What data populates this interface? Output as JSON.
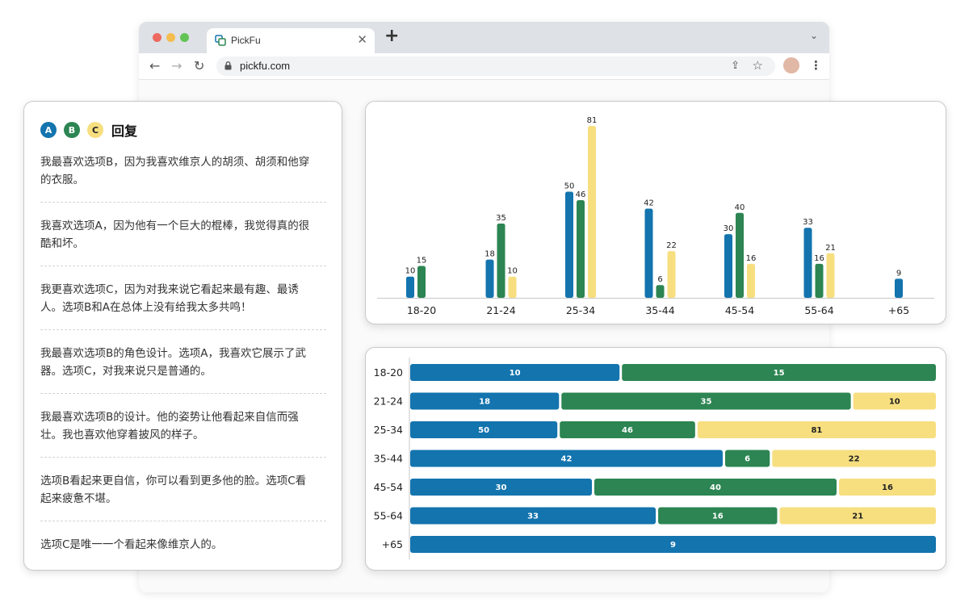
{
  "browser": {
    "tab_title": "PickFu",
    "url": "pickfu.com"
  },
  "responses": {
    "badges": [
      "A",
      "B",
      "C"
    ],
    "title": "回复",
    "items": [
      [
        "我最喜欢选项B，因为我喜欢维京人的胡须、胡须和他穿",
        "的衣服。"
      ],
      [
        "我喜欢选项A，因为他有一个巨大的棍棒，我觉得真的很",
        "酷和坏。"
      ],
      [
        "我更喜欢选项C，因为对我来说它看起来最有趣、最诱",
        "人。选项B和A在总体上没有给我太多共鸣！"
      ],
      [
        "我最喜欢选项B的角色设计。选项A，我喜欢它展示了武",
        "器。选项C，对我来说只是普通的。"
      ],
      [
        "我最喜欢选项B的设计。他的姿势让他看起来自信而强",
        "壮。我也喜欢他穿着披风的样子。"
      ],
      [
        "选项B看起来更自信，你可以看到更多他的脸。选项C看",
        "起来疲惫不堪。"
      ],
      [
        "选项C是唯一一个看起来像维京人的。"
      ]
    ]
  },
  "colors": {
    "A": "#1374ae",
    "B": "#2c8552",
    "C": "#f7df80"
  },
  "chart_data": [
    {
      "type": "bar",
      "categories": [
        "18-20",
        "21-24",
        "25-34",
        "35-44",
        "45-54",
        "55-64",
        "+65"
      ],
      "series": [
        {
          "name": "A",
          "values": [
            10,
            18,
            50,
            42,
            30,
            33,
            9
          ]
        },
        {
          "name": "B",
          "values": [
            15,
            35,
            46,
            6,
            40,
            16,
            null
          ]
        },
        {
          "name": "C",
          "values": [
            null,
            10,
            81,
            22,
            16,
            21,
            null
          ]
        }
      ]
    },
    {
      "type": "bar",
      "orientation": "horizontal",
      "stacked": true,
      "categories": [
        "18-20",
        "21-24",
        "25-34",
        "35-44",
        "45-54",
        "55-64",
        "+65"
      ],
      "series": [
        {
          "name": "A",
          "values": [
            10,
            18,
            50,
            42,
            30,
            33,
            9
          ]
        },
        {
          "name": "B",
          "values": [
            15,
            35,
            46,
            6,
            40,
            16,
            null
          ]
        },
        {
          "name": "C",
          "values": [
            null,
            10,
            81,
            22,
            16,
            21,
            null
          ]
        }
      ]
    }
  ]
}
